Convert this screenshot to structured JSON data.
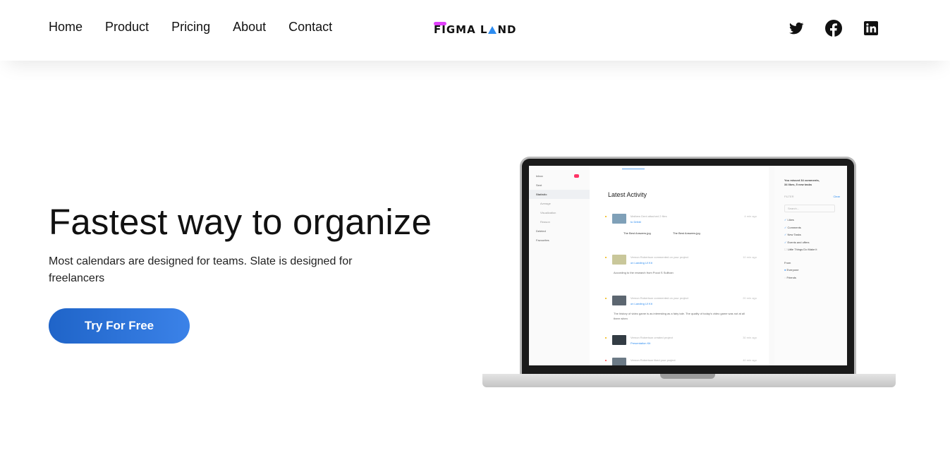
{
  "nav": {
    "links": [
      "Home",
      "Product",
      "Pricing",
      "About",
      "Contact"
    ],
    "logo": {
      "before": "FIGMA L",
      "after": "ND",
      "accent": "#e040fb",
      "triangle": "#2d8cf0"
    }
  },
  "socials": [
    {
      "name": "twitter-icon"
    },
    {
      "name": "facebook-icon"
    },
    {
      "name": "linkedin-icon"
    }
  ],
  "hero": {
    "title": "Fastest way to organize",
    "subtitle": "Most calendars are designed for teams. Slate is designed for freelancers",
    "cta": "Try For Free",
    "cta_gradient": [
      "#1f64c8",
      "#3b82e8"
    ]
  },
  "mockup": {
    "sidebar": [
      "Inbox",
      "Sent",
      "Statistic",
      "Average",
      "Visualization",
      "Reason",
      "Deleted",
      "Favourites"
    ],
    "title": "Latest Activity",
    "feed": [
      {
        "text": "Mathew Dent attached 2 files",
        "link": "to Dribbl",
        "time": "4 min ago",
        "files": [
          "The Best Answers.jpg",
          "The Best Answers.jpg"
        ]
      },
      {
        "text": "Vernon Robertson commented on your project",
        "link": "on Landing UI Kit",
        "time": "10 min ago",
        "note": "According to the research from Pocoi S Sullivan"
      },
      {
        "text": "Vernon Robertson commented on your project",
        "link": "on Landing UI Kit",
        "time": "20 min ago",
        "note": "The history of video game is as interesting as a fairy tale. The quality of today's video game was not at all there when"
      },
      {
        "text": "Vernon Robertson created project",
        "link": "Presentation Kit",
        "time": "30 min ago"
      },
      {
        "text": "Vernon Robertson liked your project",
        "link": "",
        "time": "40 min ago"
      }
    ],
    "right": {
      "missed": "You missed 34 comments,",
      "missed2": "34 likes, 5 new tasks",
      "filter": "FILTER",
      "clear": "Clear",
      "search": "Search...",
      "checks": [
        "Likes",
        "Comments",
        "New Tasks",
        "Events and offers",
        "Little Things Do Make it"
      ],
      "from": "From",
      "from_opts": [
        "Everyone",
        "Friends"
      ]
    }
  }
}
